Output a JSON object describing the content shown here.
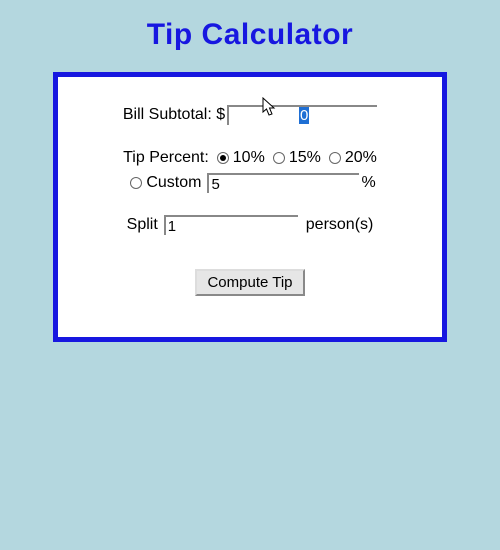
{
  "title": "Tip Calculator",
  "subtotal": {
    "label": "Bill Subtotal: $",
    "value": "0"
  },
  "tip": {
    "label": "Tip Percent:",
    "options": [
      "10%",
      "15%",
      "20%"
    ],
    "selected": "10%",
    "custom_label": "Custom",
    "custom_value": "5",
    "custom_suffix": "%"
  },
  "split": {
    "label": "Split",
    "value": "1",
    "suffix": "person(s)"
  },
  "compute": {
    "label": "Compute Tip"
  }
}
